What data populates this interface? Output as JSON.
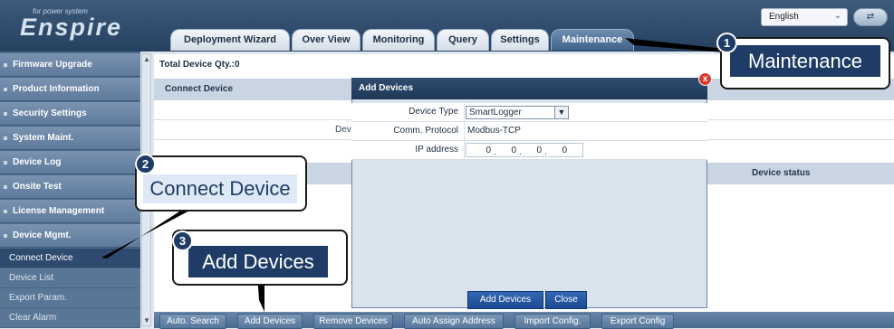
{
  "header": {
    "logo_tag": "for power system",
    "logo_text": "Enspire",
    "language": "English",
    "language_arrow": "⌄"
  },
  "tabs": [
    {
      "label": "Deployment Wizard"
    },
    {
      "label": "Over View"
    },
    {
      "label": "Monitoring"
    },
    {
      "label": "Query"
    },
    {
      "label": "Settings"
    },
    {
      "label": "Maintenance",
      "active": true
    }
  ],
  "sidebar": {
    "items": [
      {
        "label": "Firmware Upgrade"
      },
      {
        "label": "Product Information"
      },
      {
        "label": "Security Settings"
      },
      {
        "label": "System Maint."
      },
      {
        "label": "Device Log"
      },
      {
        "label": "Onsite Test"
      },
      {
        "label": "License Management"
      },
      {
        "label": "Device Mgmt."
      }
    ],
    "subitems": [
      {
        "label": "Connect Device",
        "active": true
      },
      {
        "label": "Device List"
      },
      {
        "label": "Export Param."
      },
      {
        "label": "Clear Alarm"
      }
    ]
  },
  "main": {
    "total_qty": "Total Device Qty.:0",
    "col_connect_device": "Connect Device",
    "row_partial": "Dev",
    "col_device_status": "Device status"
  },
  "dialog": {
    "title": "Add Devices",
    "close": "x",
    "fields": {
      "device_type_label": "Device Type",
      "device_type_value": "SmartLogger",
      "comm_protocol_label": "Comm. Protocol",
      "comm_protocol_value": "Modbus-TCP",
      "ip_label": "IP address",
      "ip_segments": [
        "0",
        "0",
        "0",
        "0"
      ]
    },
    "add_button": "Add Devices",
    "close_button": "Close"
  },
  "bottom_buttons": [
    {
      "label": "Auto. Search"
    },
    {
      "label": "Add Devices"
    },
    {
      "label": "Remove Devices"
    },
    {
      "label": "Auto Assign Address"
    },
    {
      "label": "Import Config."
    },
    {
      "label": "Export Config"
    }
  ],
  "callouts": [
    {
      "number": "1",
      "text": "Maintenance"
    },
    {
      "number": "2",
      "text": "Connect Device"
    },
    {
      "number": "3",
      "text": "Add Devices"
    }
  ]
}
